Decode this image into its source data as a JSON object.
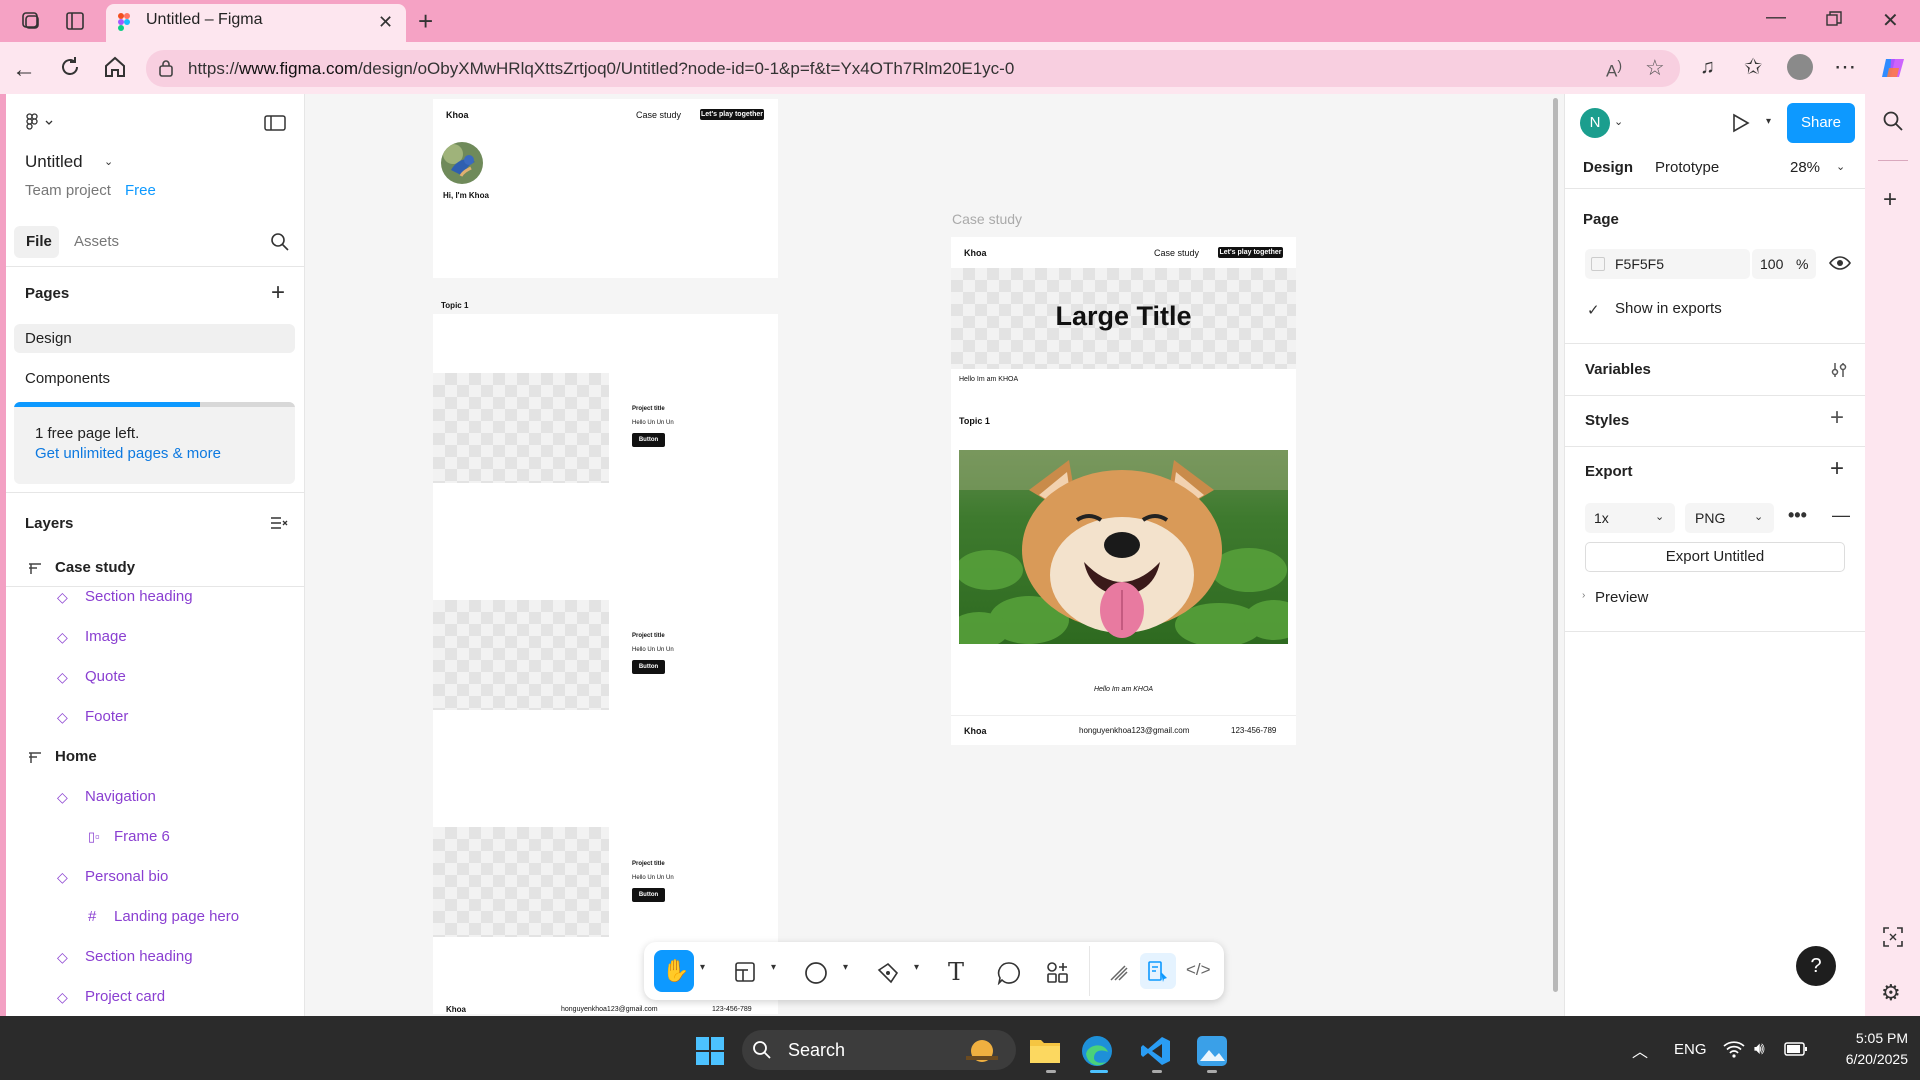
{
  "browser": {
    "tab_title": "Untitled – Figma",
    "url_prefix": "https://",
    "url_domain": "www.figma.com",
    "url_rest": "/design/oObyXMwHRlqXttsZrtjoq0/Untitled?node-id=0-1&p=f&t=Yx4OTh7Rlm20E1yc-0"
  },
  "left_panel": {
    "file_name": "Untitled",
    "team": "Team project",
    "plan": "Free",
    "tabs": [
      "File",
      "Assets"
    ],
    "pages_heading": "Pages",
    "pages": [
      "Design",
      "Components"
    ],
    "free_notice": "1 free page left.",
    "upgrade_link": "Get unlimited pages & more",
    "layers_heading": "Layers",
    "layers": [
      {
        "label": "Case study",
        "kind": "frame",
        "indent": 0
      },
      {
        "label": "Section heading",
        "kind": "component",
        "indent": 1
      },
      {
        "label": "Image",
        "kind": "component",
        "indent": 1
      },
      {
        "label": "Quote",
        "kind": "component",
        "indent": 1
      },
      {
        "label": "Footer",
        "kind": "component",
        "indent": 1
      },
      {
        "label": "Home",
        "kind": "frame",
        "indent": 0
      },
      {
        "label": "Navigation",
        "kind": "component",
        "indent": 1
      },
      {
        "label": "Frame 6",
        "kind": "autolayout",
        "indent": 2
      },
      {
        "label": "Personal bio",
        "kind": "component",
        "indent": 1
      },
      {
        "label": "Landing page hero",
        "kind": "grid",
        "indent": 2
      },
      {
        "label": "Section heading",
        "kind": "component",
        "indent": 1
      },
      {
        "label": "Project card",
        "kind": "component",
        "indent": 1
      }
    ]
  },
  "canvas": {
    "home": {
      "logo": "Khoa",
      "nav_link": "Case study",
      "cta": "Let's play together",
      "greeting": "Hi, I'm Khoa",
      "topic": "Topic 1",
      "cards": [
        {
          "title": "Project title",
          "text": "Hello Un Un Un",
          "button": "Button"
        },
        {
          "title": "Project title",
          "text": "Hello Un Un Un",
          "button": "Button"
        },
        {
          "title": "Project title",
          "text": "Hello Un Un Un",
          "button": "Button"
        }
      ],
      "footer_logo": "Khoa",
      "footer_email": "honguyenkhoa123@gmail.com",
      "footer_phone": "123-456-789"
    },
    "case_study": {
      "frame_label": "Case study",
      "logo": "Khoa",
      "nav_link": "Case study",
      "cta": "Let's play together",
      "hero_title": "Large Title",
      "intro": "Hello Im am KHOA",
      "topic": "Topic 1",
      "quote": "Hello Im am KHOA",
      "footer_logo": "Khoa",
      "footer_email": "honguyenkhoa123@gmail.com",
      "footer_phone": "123-456-789"
    }
  },
  "right_panel": {
    "avatar_initial": "N",
    "share": "Share",
    "tabs": [
      "Design",
      "Prototype"
    ],
    "zoom": "28%",
    "page_heading": "Page",
    "bg_color": "F5F5F5",
    "bg_opacity": "100",
    "percent": "%",
    "show_in_exports": "Show in exports",
    "variables": "Variables",
    "styles": "Styles",
    "export_heading": "Export",
    "export_scale": "1x",
    "export_format": "PNG",
    "export_button": "Export Untitled",
    "preview": "Preview"
  },
  "taskbar": {
    "search": "Search",
    "lang": "ENG",
    "time": "5:05 PM",
    "date": "6/20/2025"
  },
  "colors": {
    "chrome_pink": "#f5a2c4",
    "figma_blue": "#0d99ff",
    "layer_purple": "#8a3fd1",
    "canvas_bg": "#f5f5f5"
  }
}
